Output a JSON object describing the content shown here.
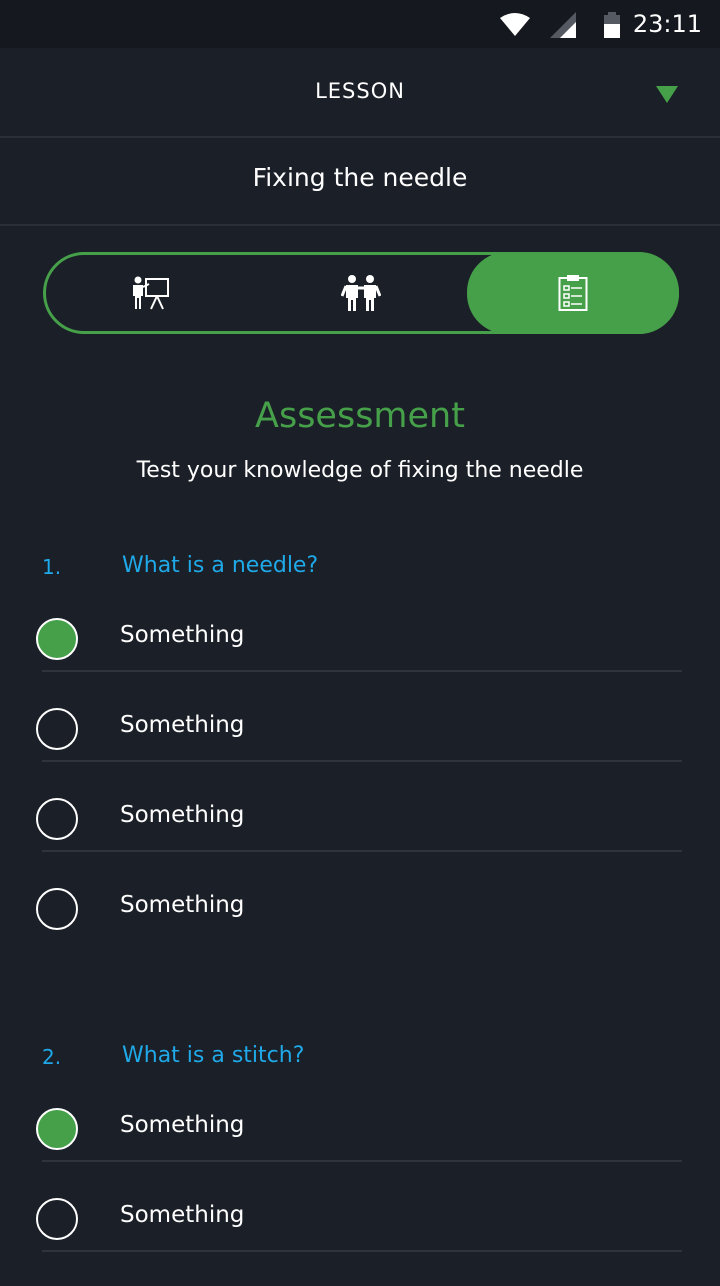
{
  "status_bar": {
    "time": "23:11"
  },
  "header": {
    "title": "LESSON"
  },
  "lesson": {
    "title": "Fixing the needle"
  },
  "tabs": [
    {
      "icon": "presentation-icon",
      "selected": false
    },
    {
      "icon": "people-icon",
      "selected": false
    },
    {
      "icon": "clipboard-icon",
      "selected": true
    }
  ],
  "assessment": {
    "heading": "Assessment",
    "subtitle": "Test your knowledge of fixing the needle"
  },
  "questions": [
    {
      "number": "1.",
      "text": "What is a needle?",
      "options": [
        {
          "label": "Something",
          "selected": true
        },
        {
          "label": "Something",
          "selected": false
        },
        {
          "label": "Something",
          "selected": false
        },
        {
          "label": "Something",
          "selected": false
        }
      ]
    },
    {
      "number": "2.",
      "text": "What is a stitch?",
      "options": [
        {
          "label": "Something",
          "selected": true
        },
        {
          "label": "Something",
          "selected": false
        }
      ]
    }
  ],
  "colors": {
    "accent": "#46a04a",
    "question": "#1fa9e8",
    "background": "#1b1f27"
  }
}
